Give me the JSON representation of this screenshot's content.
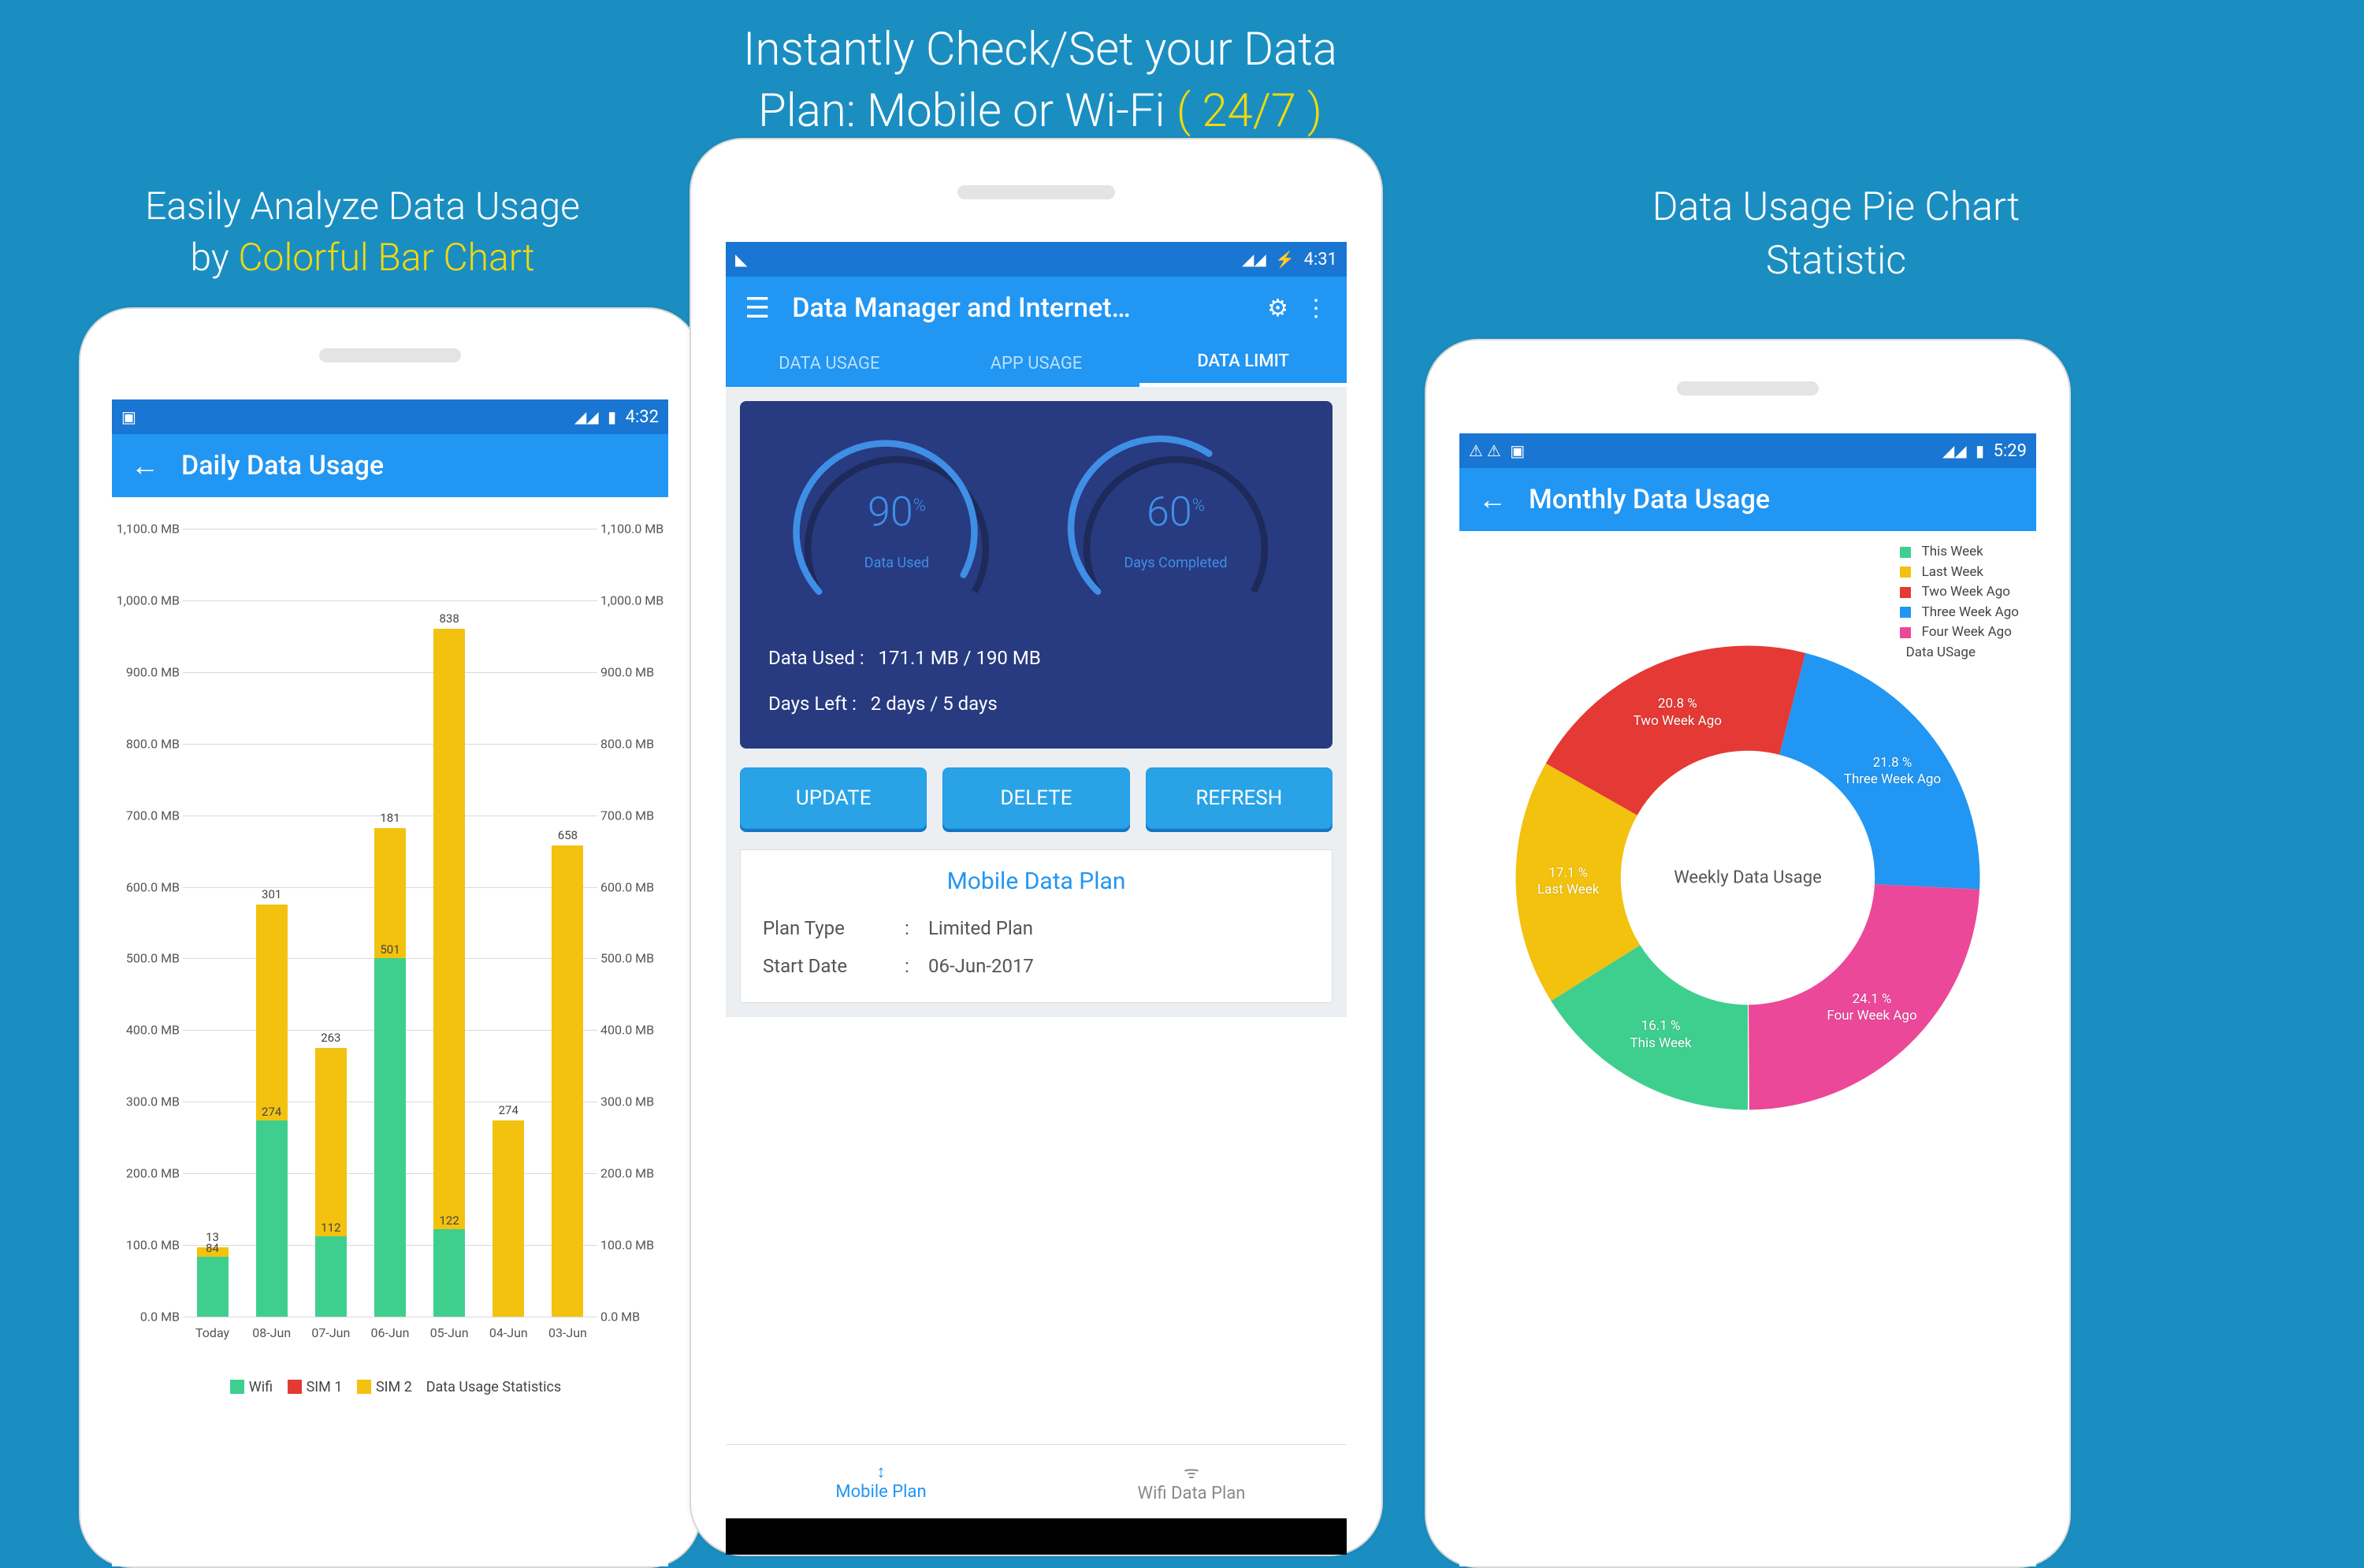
{
  "captions": {
    "left_l1": "Easily Analyze Data Usage",
    "left_by": "by ",
    "left_hl": "Colorful Bar Chart",
    "center_l1": "Instantly Check/Set your Data",
    "center_l2a": "Plan: Mobile or Wi-Fi ",
    "center_hl": "( 24/7 )",
    "right_l1": "Data Usage Pie Chart",
    "right_l2": "Statistic"
  },
  "status": {
    "left_time": "4:32",
    "mid_time": "4:31",
    "right_time": "5:29"
  },
  "left_screen": {
    "title": "Daily Data Usage",
    "legend": {
      "wifi": "Wifi",
      "sim1": "SIM 1",
      "sim2": "SIM 2",
      "title": "Data Usage Statistics"
    },
    "colors": {
      "wifi": "#3ecf8e",
      "sim1": "#e53935",
      "sim2": "#f2c20f"
    }
  },
  "mid_screen": {
    "title": "Data Manager and Internet…",
    "tabs": [
      "DATA USAGE",
      "APP USAGE",
      "DATA LIMIT"
    ],
    "gauge1": {
      "value": "90",
      "unit": "%",
      "label": "Data Used"
    },
    "gauge2": {
      "value": "60",
      "unit": "%",
      "label": "Days Completed"
    },
    "rows": {
      "data_used_k": "Data Used  :",
      "data_used_v": "171.1 MB / 190 MB",
      "days_left_k": "Days Left  :",
      "days_left_v": "2 days / 5 days"
    },
    "buttons": [
      "UPDATE",
      "DELETE",
      "REFRESH"
    ],
    "plan": {
      "title": "Mobile Data Plan",
      "type_k": "Plan Type",
      "type_v": "Limited Plan",
      "start_k": "Start Date",
      "start_v": "06-Jun-2017"
    },
    "bottom_tabs": {
      "mobile": "Mobile Plan",
      "wifi": "Wifi Data Plan"
    }
  },
  "right_screen": {
    "title": "Monthly Data Usage",
    "center_label": "Weekly Data Usage",
    "legend_extra": "Data USage",
    "legend": [
      {
        "name": "This Week",
        "color": "#3ecf8e"
      },
      {
        "name": "Last Week",
        "color": "#f2c20f"
      },
      {
        "name": "Two Week Ago",
        "color": "#e53935"
      },
      {
        "name": "Three Week Ago",
        "color": "#2196f3"
      },
      {
        "name": "Four Week Ago",
        "color": "#ec4899"
      }
    ]
  },
  "chart_data": [
    {
      "type": "bar",
      "title": "Daily Data Usage",
      "ylabel": "MB",
      "ylim": [
        0,
        1100
      ],
      "yticks": [
        "0.0 MB",
        "100.0 MB",
        "200.0 MB",
        "300.0 MB",
        "400.0 MB",
        "500.0 MB",
        "600.0 MB",
        "700.0 MB",
        "800.0 MB",
        "900.0 MB",
        "1,000.0 MB",
        "1,100.0 MB"
      ],
      "categories": [
        "Today",
        "08-Jun",
        "07-Jun",
        "06-Jun",
        "05-Jun",
        "04-Jun",
        "03-Jun"
      ],
      "series": [
        {
          "name": "Wifi",
          "color": "#3ecf8e",
          "values": [
            84,
            274,
            112,
            501,
            122,
            0,
            0
          ]
        },
        {
          "name": "SIM 2",
          "color": "#f2c20f",
          "values": [
            13,
            301,
            263,
            181,
            838,
            274,
            658
          ]
        }
      ],
      "sim1_values": [
        0,
        0,
        0,
        0,
        0,
        0,
        0
      ]
    },
    {
      "type": "pie",
      "title": "Weekly Data Usage",
      "slices": [
        {
          "name": "This Week",
          "pct": 16.1,
          "color": "#3ecf8e"
        },
        {
          "name": "Last Week",
          "pct": 17.1,
          "color": "#f2c20f"
        },
        {
          "name": "Two Week Ago",
          "pct": 20.8,
          "color": "#e53935"
        },
        {
          "name": "Three Week Ago",
          "pct": 21.8,
          "color": "#2196f3"
        },
        {
          "name": "Four Week Ago",
          "pct": 24.1,
          "color": "#ec4899"
        }
      ]
    }
  ]
}
